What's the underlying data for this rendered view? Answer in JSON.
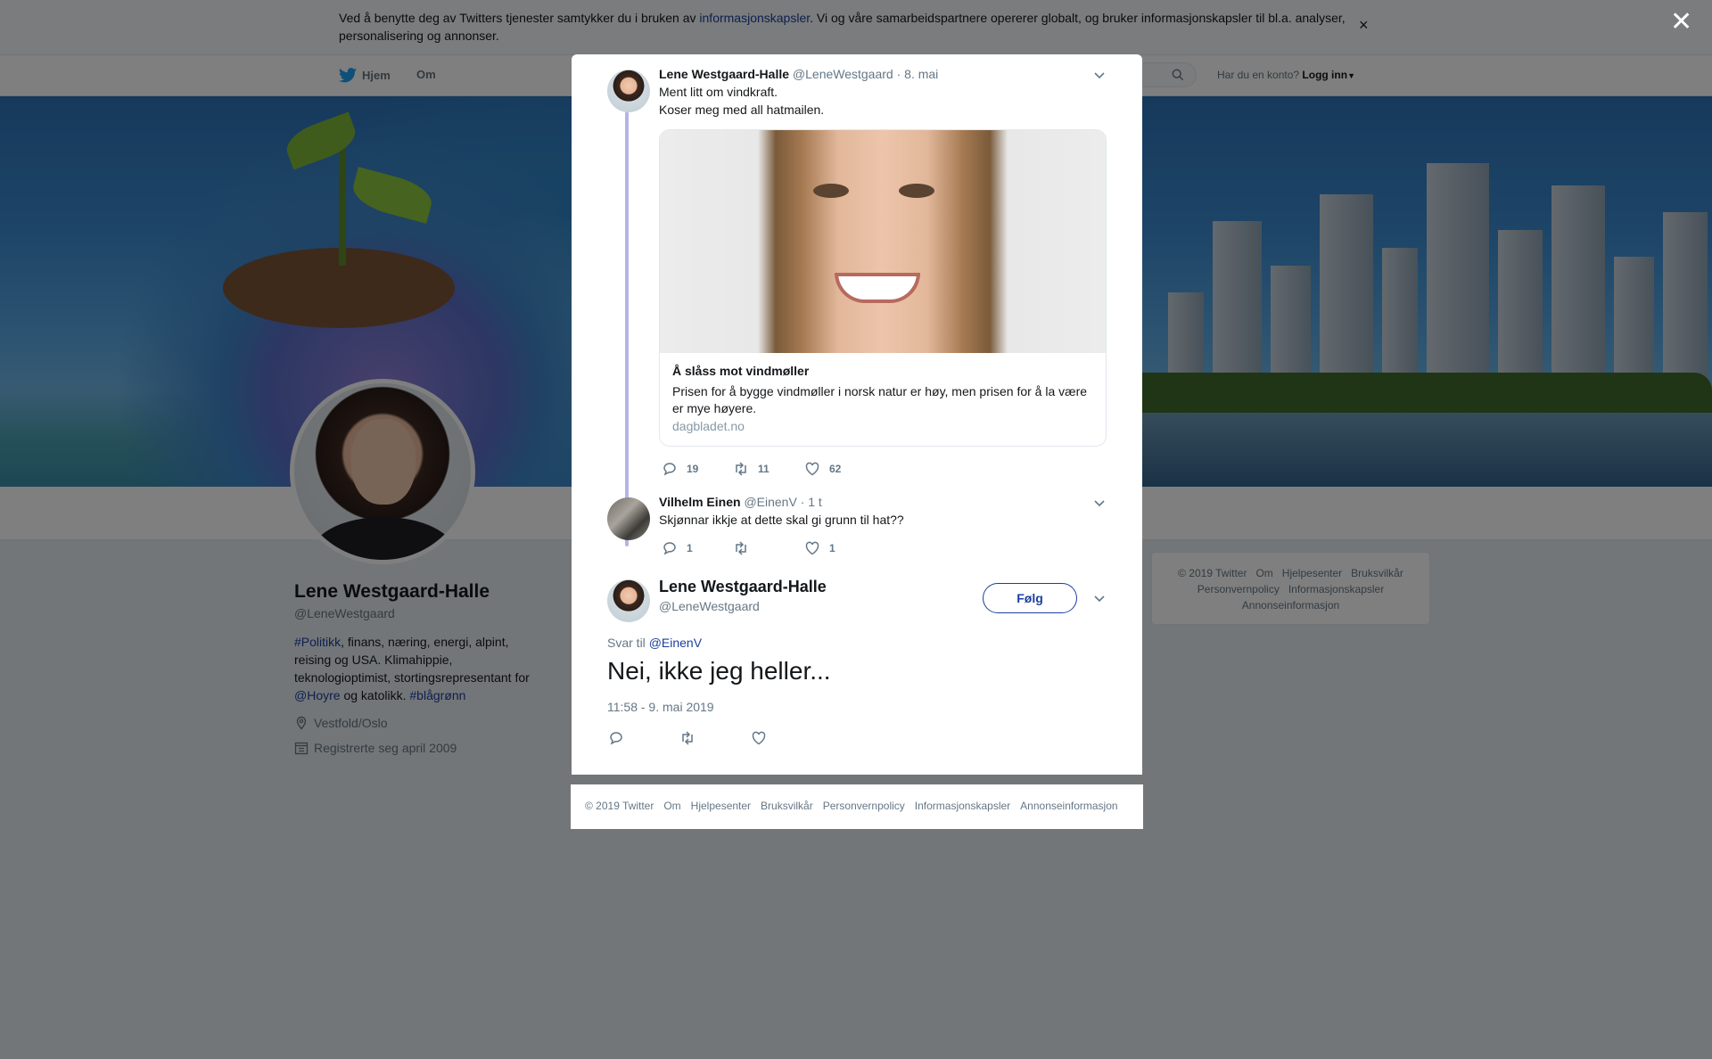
{
  "consent": {
    "text_before": "Ved å benytte deg av Twitters tjenester samtykker du i bruken av ",
    "link": "informasjonskapsler",
    "text_after": ". Vi og våre samarbeidspartnere opererer globalt, og bruker informasjonskapsler til bl.a. analyser, personalisering og annonser.",
    "close": "×"
  },
  "topnav": {
    "home": "Hjem",
    "about": "Om",
    "account_prompt": "Har du en konto?",
    "login": "Logg inn"
  },
  "profile": {
    "name": "Lene Westgaard-Halle",
    "handle": "@LeneWestgaard",
    "bio": {
      "tag1": "#Politikk",
      "part1": ", finans, næring, energi, alpint, reising og USA. Klimahippie, teknologioptimist, stortingsrepresentant for ",
      "mention": "@Hoyre",
      "part2": " og katolikk. ",
      "tag2": "#blågrønn"
    },
    "location": "Vestfold/Oslo",
    "joined": "Registrerte seg april 2009"
  },
  "right_footer": {
    "links": [
      "© 2019 Twitter",
      "Om",
      "Hjelpesenter",
      "Bruksvilkår",
      "Personvernpolicy",
      "Informasjonskapsler",
      "Annonseinformasjon"
    ]
  },
  "modal": {
    "close": "✕",
    "tweet1": {
      "name": "Lene Westgaard-Halle",
      "handle": "@LeneWestgaard",
      "time": "· 8. mai",
      "text_line1": "Ment litt om vindkraft.",
      "text_line2": "Koser meg med all hatmailen.",
      "card": {
        "title": "Å slåss mot vindmøller",
        "description": "Prisen for å bygge vindmøller i norsk natur er høy, men prisen for å la være er mye høyere.",
        "domain": "dagbladet.no"
      },
      "replies": "19",
      "retweets": "11",
      "likes": "62"
    },
    "tweet2": {
      "name": "Vilhelm Einen",
      "handle": "@EinenV",
      "time": "· 1 t",
      "text": "Skjønnar ikkje at dette skal gi grunn til hat??",
      "replies": "1",
      "retweets": "",
      "likes": "1"
    },
    "main_tweet": {
      "name": "Lene Westgaard-Halle",
      "handle": "@LeneWestgaard",
      "follow": "Følg",
      "reply_prefix": "Svar til ",
      "reply_to": "@EinenV",
      "text": "Nei, ikke jeg heller...",
      "timestamp": "11:58 - 9. mai 2019"
    }
  },
  "modal_footer": {
    "links": [
      "© 2019 Twitter",
      "Om",
      "Hjelpesenter",
      "Bruksvilkår",
      "Personvernpolicy",
      "Informasjonskapsler",
      "Annonseinformasjon"
    ]
  },
  "colors": {
    "link": "#1b3f9e",
    "thread_line": "#b4b4e8",
    "muted": "#657786"
  }
}
